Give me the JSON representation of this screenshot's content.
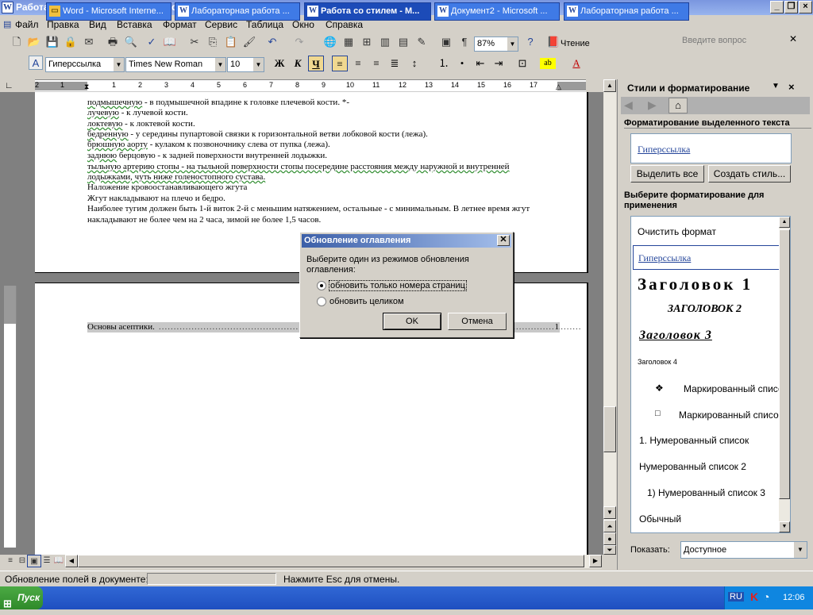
{
  "window": {
    "title": "Работа со стилем - Microsoft Word"
  },
  "menu": {
    "items": [
      "Файл",
      "Правка",
      "Вид",
      "Вставка",
      "Формат",
      "Сервис",
      "Таблица",
      "Окно",
      "Справка"
    ],
    "ask_placeholder": "Введите вопрос"
  },
  "toolbar": {
    "zoom": "87%",
    "reading_label": "Чтение",
    "style": "Гиперссылка",
    "font": "Times New Roman",
    "size": "10",
    "bold_label": "Ж",
    "italic_label": "К",
    "underline_label": "Ч"
  },
  "ruler": {
    "marks": [
      "2",
      "1",
      "1",
      "2",
      "3",
      "4",
      "5",
      "6",
      "7",
      "8",
      "9",
      "10",
      "11",
      "12",
      "13",
      "14",
      "15",
      "16",
      "17"
    ]
  },
  "document": {
    "page1_lines": [
      {
        "ul": "подмышечную",
        "rest": " - в подмышечной впадине к головке плечевой кости. *-"
      },
      {
        "ul": "лучевую",
        "rest": " - к лучевой кости."
      },
      {
        "ul": "локтевую",
        "rest": " - к локтевой кости."
      },
      {
        "ul": "бедренную",
        "rest": " - у середины пупартовой связки к горизонтальной ветви лобковой кости (лежа)."
      },
      {
        "ul": "брюшную аорту",
        "rest": " - кулаком к позвоночнику слева от пупка (лежа)."
      },
      {
        "ul": "заднюю",
        "rest": " берцовую - к задней поверхности внутренней лодыжки."
      },
      {
        "ul": "тыльную артерию стопы - на тыльной поверхности стопы посередине расстояния между наружной и внутренней",
        "rest": ""
      },
      {
        "ul": "лодыжками, чуть ниже голеностопного сустава.",
        "rest": ""
      },
      {
        "ul": "",
        "rest": "Наложение кровоостанавливающего жгута"
      },
      {
        "ul": "",
        "rest": "Жгут накладывают на плечо и бедро."
      },
      {
        "ul": "",
        "rest": "Наиболее тугим должен быть 1-й виток 2-й с меньшим натяжением, остальные - с минимальным. В летнее время жгут"
      },
      {
        "ul": "",
        "rest": "накладывают не более чем на 2 часа, зимой не более 1,5 часов."
      }
    ],
    "toc_entry": "Основы асептики.",
    "toc_page": "1"
  },
  "dialog": {
    "title": "Обновление оглавления",
    "prompt": "Выберите один из режимов обновления оглавления:",
    "option1": "обновить только номера страниц",
    "option2": "обновить целиком",
    "option_selected": 1,
    "ok": "OK",
    "cancel": "Отмена"
  },
  "taskpane": {
    "title": "Стили и форматирование",
    "section_selected": "Форматирование выделенного текста",
    "selected_style": "Гиперссылка",
    "select_all": "Выделить все",
    "new_style": "Создать стиль...",
    "section_apply": "Выберите форматирование для применения",
    "styles": [
      {
        "name": "Очистить формат",
        "mark": ""
      },
      {
        "name": "Гиперссылка",
        "mark": "a"
      },
      {
        "name": "Заголовок 1",
        "mark": "¶"
      },
      {
        "name": "ЗАГОЛОВОК 2",
        "mark": "¶"
      },
      {
        "name": "Заголовок 3",
        "mark": "¶"
      },
      {
        "name": "Заголовок 4",
        "mark": "¶"
      },
      {
        "name": "Маркированный список",
        "mark": "¶"
      },
      {
        "name": "Маркированный список",
        "mark": "¶"
      },
      {
        "name": "1.  Нумерованный список",
        "mark": "¶"
      },
      {
        "name": "Нумерованный список 2",
        "mark": "¶"
      },
      {
        "name": "1)  Нумерованный список 3",
        "mark": "¶"
      },
      {
        "name": "Обычный",
        "mark": "¶"
      }
    ],
    "show_label": "Показать:",
    "show_value": "Доступное"
  },
  "statusbar": {
    "left": "Обновление полей в документе:",
    "right": "Нажмите Esc для отмены."
  },
  "taskbar": {
    "start": "Пуск",
    "tasks": [
      {
        "label": "Word - Microsoft Interne...",
        "active": false
      },
      {
        "label": "Лабораторная работа ...",
        "active": false
      },
      {
        "label": "Работа со стилем - М...",
        "active": true
      },
      {
        "label": "Документ2 - Microsoft ...",
        "active": false
      },
      {
        "label": "Лабораторная работа ...",
        "active": false
      }
    ],
    "lang": "RU",
    "clock": "12:06"
  }
}
